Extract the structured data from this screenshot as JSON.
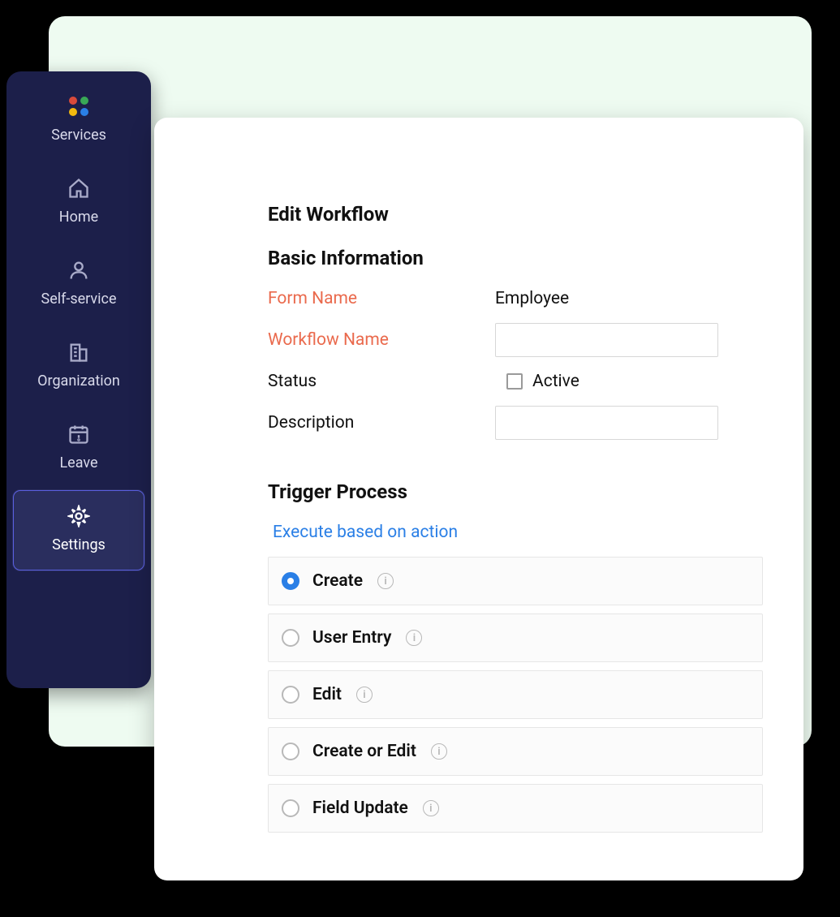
{
  "sidebar": {
    "items": [
      {
        "id": "services",
        "label": "Services"
      },
      {
        "id": "home",
        "label": "Home"
      },
      {
        "id": "self-service",
        "label": "Self-service"
      },
      {
        "id": "organization",
        "label": "Organization"
      },
      {
        "id": "leave",
        "label": "Leave"
      },
      {
        "id": "settings",
        "label": "Settings"
      }
    ],
    "active_id": "settings",
    "dot_colors": [
      "#d94a3b",
      "#39a856",
      "#f2b90f",
      "#2a7fe6"
    ]
  },
  "main": {
    "page_title": "Edit Workflow",
    "section_basic": "Basic Information",
    "labels": {
      "form_name": "Form Name",
      "workflow_name": "Workflow Name",
      "status": "Status",
      "description": "Description"
    },
    "values": {
      "form_name": "Employee",
      "workflow_name": "",
      "status_active_label": "Active",
      "status_active_checked": false,
      "description": ""
    },
    "section_trigger": "Trigger Process",
    "trigger_link": "Execute based on action",
    "trigger_options": [
      {
        "id": "create",
        "label": "Create",
        "selected": true
      },
      {
        "id": "user-entry",
        "label": "User Entry",
        "selected": false
      },
      {
        "id": "edit",
        "label": "Edit",
        "selected": false
      },
      {
        "id": "create-or-edit",
        "label": "Create or Edit",
        "selected": false
      },
      {
        "id": "field-update",
        "label": "Field Update",
        "selected": false
      }
    ]
  }
}
